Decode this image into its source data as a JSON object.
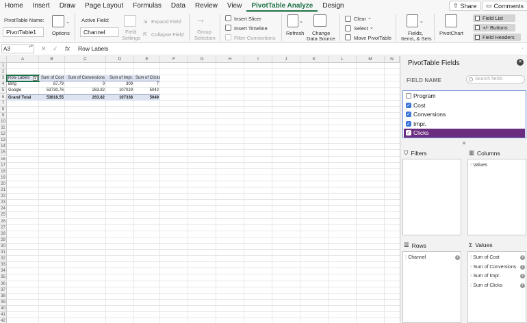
{
  "menu": {
    "tabs": [
      "Home",
      "Insert",
      "Draw",
      "Page Layout",
      "Formulas",
      "Data",
      "Review",
      "View",
      "PivotTable Analyze",
      "Design"
    ],
    "active": "PivotTable Analyze",
    "share": "Share",
    "comments": "Comments"
  },
  "ribbon": {
    "pivot_name_label": "PivotTable Name:",
    "pivot_name_value": "PivotTable1",
    "options": "Options",
    "active_field_label": "Active Field:",
    "active_field_value": "Channel",
    "field_settings_1": "Field",
    "field_settings_2": "Settings",
    "expand_field": "Expand Field",
    "collapse_field": "Collapse Field",
    "group_selection_1": "Group",
    "group_selection_2": "Selection",
    "insert_slicer": "Insert Slicer",
    "insert_timeline": "Insert Timeline",
    "filter_connections": "Filter Connections",
    "refresh": "Refresh",
    "change_source_1": "Change",
    "change_source_2": "Data Source",
    "clear": "Clear",
    "select": "Select",
    "move_pivot": "Move PivotTable",
    "fields_items_1": "Fields,",
    "fields_items_2": "Items, & Sets",
    "pivotchart": "PivotChart",
    "field_list": "Field List",
    "buttons": "+/- Buttons",
    "field_headers": "Field Headers"
  },
  "formula_bar": {
    "cell_ref": "A3",
    "content": "Row Labels"
  },
  "sheet": {
    "columns": [
      "A",
      "B",
      "C",
      "D",
      "E",
      "F",
      "G",
      "H",
      "I",
      "J",
      "K",
      "L",
      "M",
      "N"
    ],
    "rows": [
      "1",
      "2",
      "3",
      "4",
      "5",
      "6",
      "7",
      "8",
      "9",
      "10",
      "11",
      "12",
      "13",
      "14",
      "15",
      "16",
      "17",
      "18",
      "19",
      "20",
      "21",
      "22",
      "23",
      "24",
      "25",
      "26",
      "27",
      "28",
      "29",
      "30",
      "31",
      "32",
      "33",
      "34",
      "35",
      "36",
      "37",
      "38",
      "39",
      "40",
      "41",
      "42"
    ],
    "pivot": {
      "headers": [
        "Row Labels",
        "Sum of Cost",
        "Sum of Conversions",
        "Sum of Impr.",
        "Sum of Clicks"
      ],
      "rows": [
        [
          "Bing",
          "87.79",
          "0",
          "309",
          "7"
        ],
        [
          "Google",
          "53730.76",
          "263.82",
          "107029",
          "5042"
        ]
      ],
      "total": [
        "Grand Total",
        "53818.55",
        "263.82",
        "107338",
        "5049"
      ]
    }
  },
  "panel": {
    "title": "PivotTable Fields",
    "field_name_label": "FIELD NAME",
    "search_placeholder": "Search fields",
    "fields": [
      {
        "label": "Program",
        "checked": false
      },
      {
        "label": "Cost",
        "checked": true
      },
      {
        "label": "Conversions",
        "checked": true
      },
      {
        "label": "Impr.",
        "checked": true
      },
      {
        "label": "Clicks",
        "checked": true
      }
    ],
    "filters_label": "Filters",
    "columns_label": "Columns",
    "columns_items": [
      "Values"
    ],
    "rows_label": "Rows",
    "rows_items": [
      "Channel"
    ],
    "values_label": "Values",
    "values_items": [
      "Sum of Cost",
      "Sum of Conversions",
      "Sum of Impr.",
      "Sum of Clicks"
    ]
  }
}
